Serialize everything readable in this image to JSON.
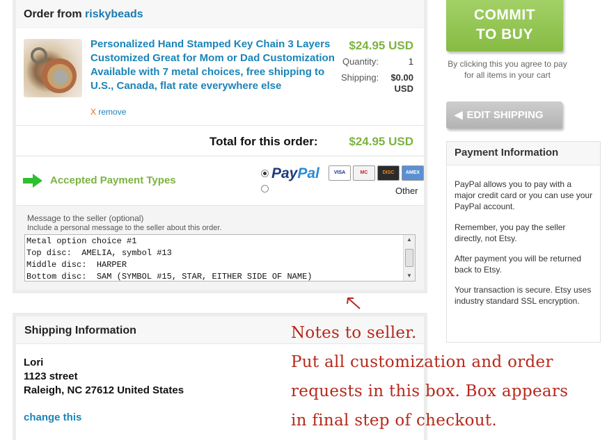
{
  "order": {
    "title_prefix": "Order from",
    "shop_name": "riskybeads",
    "item": {
      "title": "Personalized Hand Stamped Key Chain 3 Layers Customized Great for Mom or Dad Customization Available with 7 metal choices, free shipping to U.S., Canada, flat rate everywhere else",
      "remove_x": "X",
      "remove_label": "remove",
      "price": "$24.95 USD",
      "quantity_label": "Quantity:",
      "quantity_value": "1",
      "shipping_label": "Shipping:",
      "shipping_value_line1": "$0.00",
      "shipping_value_line2": "USD"
    },
    "total_label": "Total for this order:",
    "total_value": "$24.95 USD",
    "accepted_payment_label": "Accepted Payment Types",
    "paypal_pay": "Pay",
    "paypal_pal": "Pal",
    "cards": [
      "VISA",
      "MC",
      "DISC",
      "AMEX"
    ],
    "other_label": "Other",
    "message": {
      "label": "Message to the seller (optional)",
      "help": "Include a personal message to the seller about this order.",
      "text": "Metal option choice #1\nTop disc:  AMELIA, symbol #13\nMiddle disc:  HARPER\nBottom disc:  SAM (SYMBOL #15, STAR, EITHER SIDE OF NAME)"
    }
  },
  "shipping": {
    "title": "Shipping Information",
    "name": "Lori",
    "street": "1123 street",
    "city_line": "Raleigh, NC 27612 United States",
    "change_label": "change this"
  },
  "sidebar": {
    "commit_line1": "COMMIT",
    "commit_line2": "TO BUY",
    "commit_note": "By clicking this you agree to pay for all items in your cart",
    "edit_shipping_label": "EDIT SHIPPING",
    "payment_info_title": "Payment Information",
    "payment_info_paragraphs": [
      "PayPal allows you to pay with a major credit card or you can use your PayPal account.",
      "Remember, you pay the seller directly, not Etsy.",
      "After payment you will be returned back to Etsy.",
      "Your transaction is secure. Etsy uses industry standard SSL encryption."
    ]
  },
  "annotation": {
    "lines": [
      "Notes to seller.",
      "Put all customization and order",
      "requests in this box.  Box appears",
      "in final step of checkout."
    ]
  },
  "colors": {
    "link_blue": "#1b84b8",
    "price_green": "#7cb342",
    "annotation_red": "#b5291c"
  }
}
